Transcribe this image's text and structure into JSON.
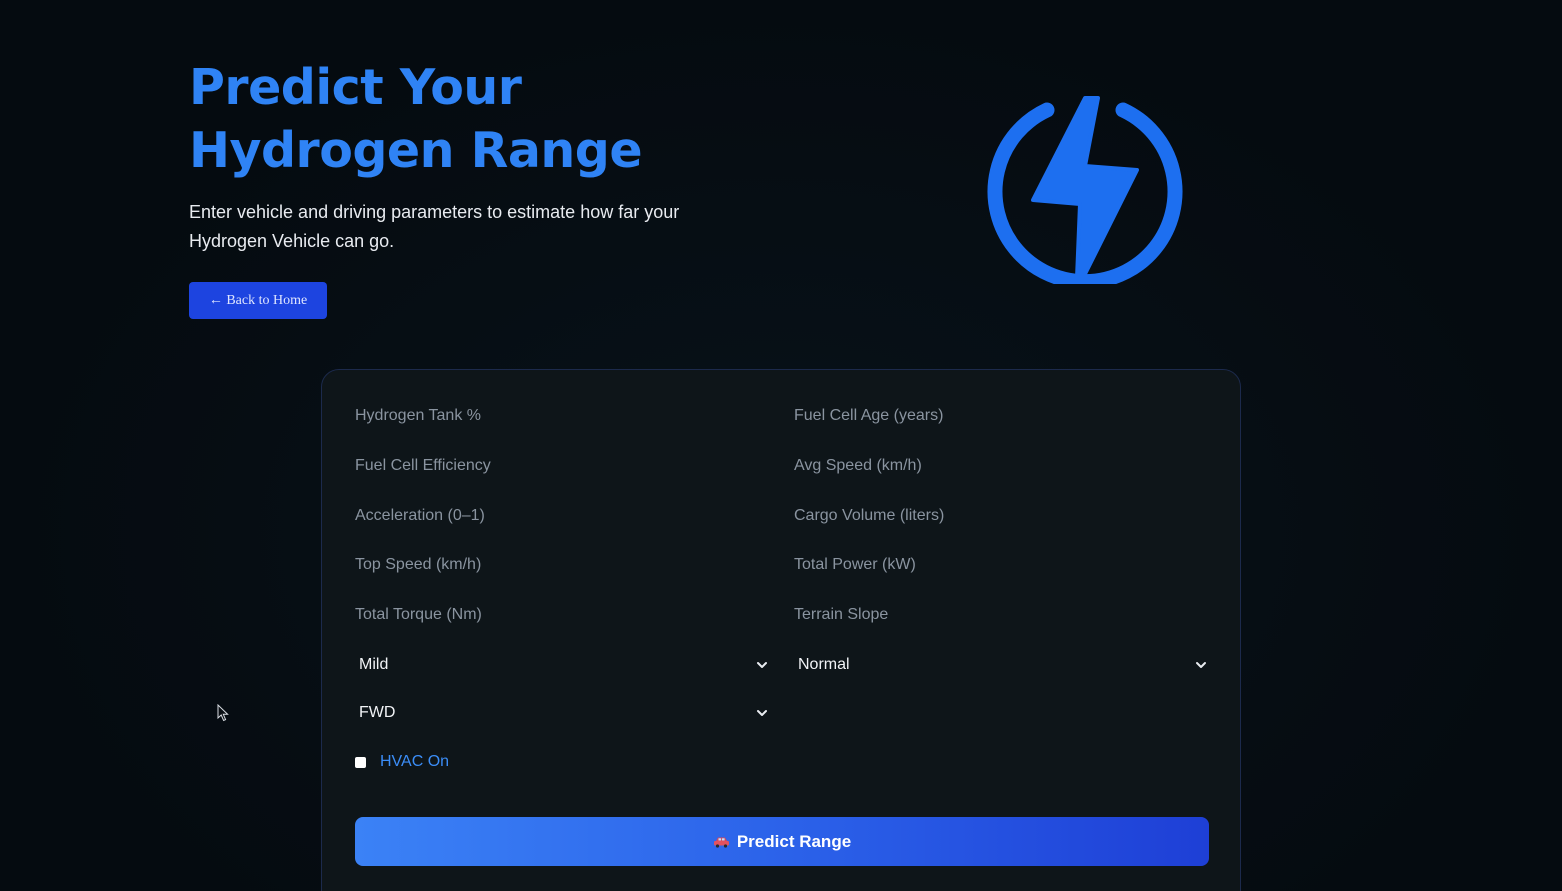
{
  "hero": {
    "title": "Predict Your Hydrogen Range",
    "subtitle": "Enter vehicle and driving parameters to estimate how far your Hydrogen Vehicle can go.",
    "back_button": "← Back to Home",
    "accent_color": "#2f83f5"
  },
  "form": {
    "fields": [
      "Hydrogen Tank %",
      "Fuel Cell Age (years)",
      "Fuel Cell Efficiency",
      "Avg Speed (km/h)",
      "Acceleration (0–1)",
      "Cargo Volume (liters)",
      "Top Speed (km/h)",
      "Total Power (kW)",
      "Total Torque (Nm)",
      "Terrain Slope"
    ],
    "selects": [
      {
        "value": "Mild"
      },
      {
        "value": "Normal"
      },
      {
        "value": "FWD"
      }
    ],
    "hvac": {
      "label": "HVAC On",
      "checked": false
    },
    "predict_button": "Predict Range",
    "predict_icon": "car-icon"
  },
  "colors": {
    "background": "#050b10",
    "card": "#0e1519",
    "button_primary": "#1d44e0",
    "predict_gradient_start": "#3b82f6",
    "predict_gradient_end": "#1e3fd6"
  }
}
